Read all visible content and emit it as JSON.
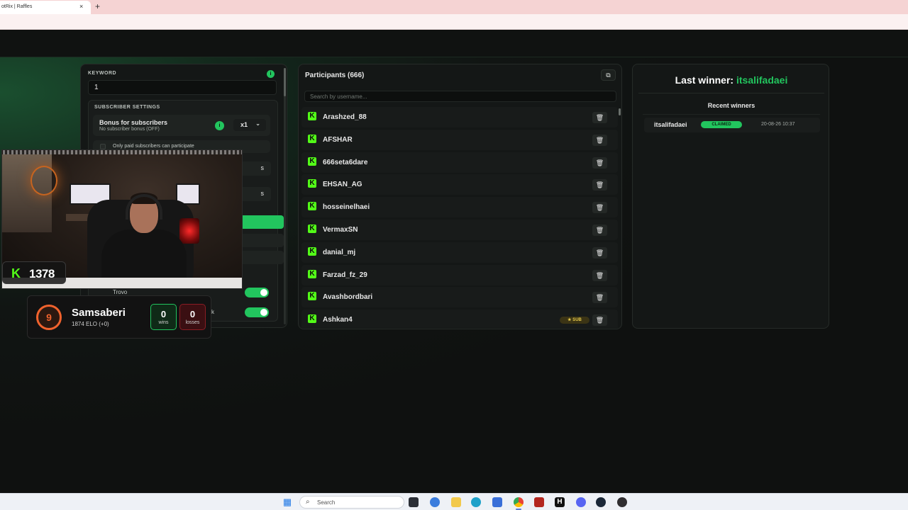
{
  "browser": {
    "tab_title": "otRix | Raffles",
    "tab_close": "×",
    "new_tab": "+"
  },
  "settings": {
    "keyword_label": "KEYWORD",
    "keyword_info": "i",
    "keyword_value": "1",
    "subscriber_heading": "SUBSCRIBER SETTINGS",
    "bonus_title": "Bonus for subscribers",
    "bonus_subtitle": "No subscriber bonus (OFF)",
    "bonus_info": "i",
    "multiplier": "x1",
    "paid_only_label": "Only paid subscribers can participate",
    "dropdown_suffix_1": "s",
    "dropdown_suffix_2": "s",
    "trovo_label": "Trovo",
    "toggle_label_2": "k",
    "chevron": "⌄"
  },
  "overlay": {
    "kick_letter": "K",
    "kick_count": "1378",
    "level": "9",
    "player_name": "Samsaberi",
    "elo_text": "1874 ELO (+0)",
    "wins": "0",
    "wins_label": "wins",
    "losses": "0",
    "losses_label": "losses",
    "colors": {
      "faceit_orange": "#f0622d",
      "kick_green": "#53fc18"
    }
  },
  "participants": {
    "title": "Participants (666)",
    "copy_icon": "⧉",
    "search_placeholder": "Search by username...",
    "sub_badge": "★ SUB",
    "delete_icon": "🗑",
    "list": [
      {
        "name": "Arashzed_88",
        "sub": false
      },
      {
        "name": "AFSHAR",
        "sub": false
      },
      {
        "name": "666seta6dare",
        "sub": false
      },
      {
        "name": "EHSAN_AG",
        "sub": false
      },
      {
        "name": "hosseinelhaei",
        "sub": false
      },
      {
        "name": "VermaxSN",
        "sub": false
      },
      {
        "name": "danial_mj",
        "sub": false
      },
      {
        "name": "Farzad_fz_29",
        "sub": false
      },
      {
        "name": "Avashbordbari",
        "sub": false
      },
      {
        "name": "Ashkan4",
        "sub": true
      }
    ]
  },
  "winners": {
    "title_prefix": "Last winner: ",
    "last_winner": "itsalifadaei",
    "recent_title": "Recent winners",
    "recent": [
      {
        "name": "itsalifadaei",
        "status": "CLAIMED",
        "date": "20-08-26 10:37"
      }
    ]
  },
  "taskbar": {
    "search_placeholder": "Search",
    "icons": [
      "windows-start-icon",
      "search-icon",
      "task-view-icon",
      "widgets-icon",
      "file-explorer-icon",
      "edge-icon",
      "store-icon",
      "chrome-icon",
      "app-icon",
      "h-app-icon",
      "discord-icon",
      "steam-icon",
      "obs-icon"
    ]
  },
  "colors": {
    "accent": "#22c55e",
    "background": "#0f1110",
    "panel": "#141716"
  }
}
